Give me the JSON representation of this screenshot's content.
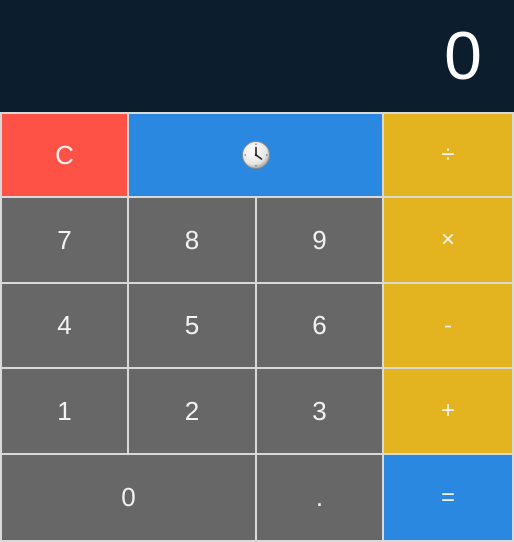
{
  "display": {
    "value": "0"
  },
  "keys": {
    "clear": "C",
    "history_icon": "clock-icon",
    "divide": "÷",
    "seven": "7",
    "eight": "8",
    "nine": "9",
    "multiply": "×",
    "four": "4",
    "five": "5",
    "six": "6",
    "subtract": "-",
    "one": "1",
    "two": "2",
    "three": "3",
    "add": "+",
    "zero": "0",
    "decimal": ".",
    "equals": "="
  },
  "colors": {
    "display_bg": "#0c1e2e",
    "number_key": "#676767",
    "clear_key": "#ff5247",
    "accent_blue": "#2b88e0",
    "operator_key": "#e3b41f"
  }
}
